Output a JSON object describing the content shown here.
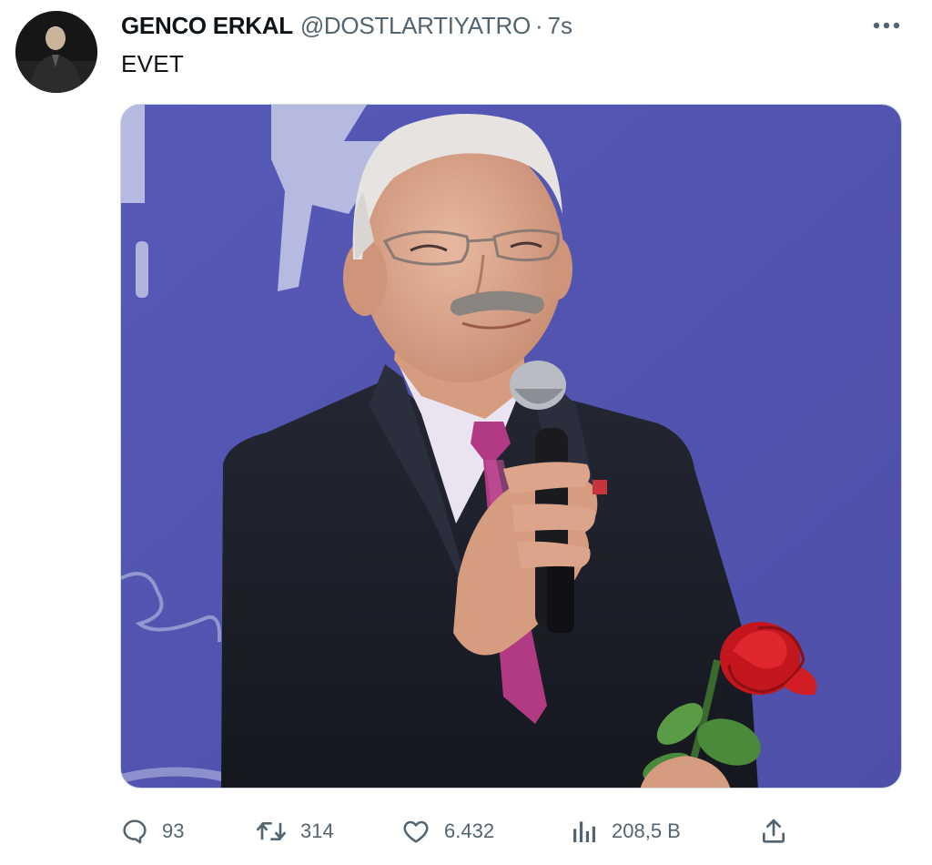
{
  "tweet": {
    "author": {
      "display_name": "GENCO ERKAL",
      "handle": "@DOSTLARTIYATRO",
      "avatar_icon": "profile-avatar"
    },
    "separator": "·",
    "timestamp": "7s",
    "text": "EVET",
    "more_icon": "more-horizontal-icon",
    "media": {
      "type": "photo",
      "subject": "smiling man in dark suit and pink tie holding a microphone and a red rose",
      "background_color": "#5558b2"
    },
    "actions": {
      "reply": {
        "icon": "reply-icon",
        "count": "93"
      },
      "retweet": {
        "icon": "retweet-icon",
        "count": "314"
      },
      "like": {
        "icon": "heart-icon",
        "count": "6.432"
      },
      "views": {
        "icon": "analytics-icon",
        "count": "208,5 B"
      },
      "share": {
        "icon": "share-icon"
      }
    }
  },
  "colors": {
    "text_primary": "#0f1419",
    "text_secondary": "#536471",
    "border": "#cfd9de"
  }
}
